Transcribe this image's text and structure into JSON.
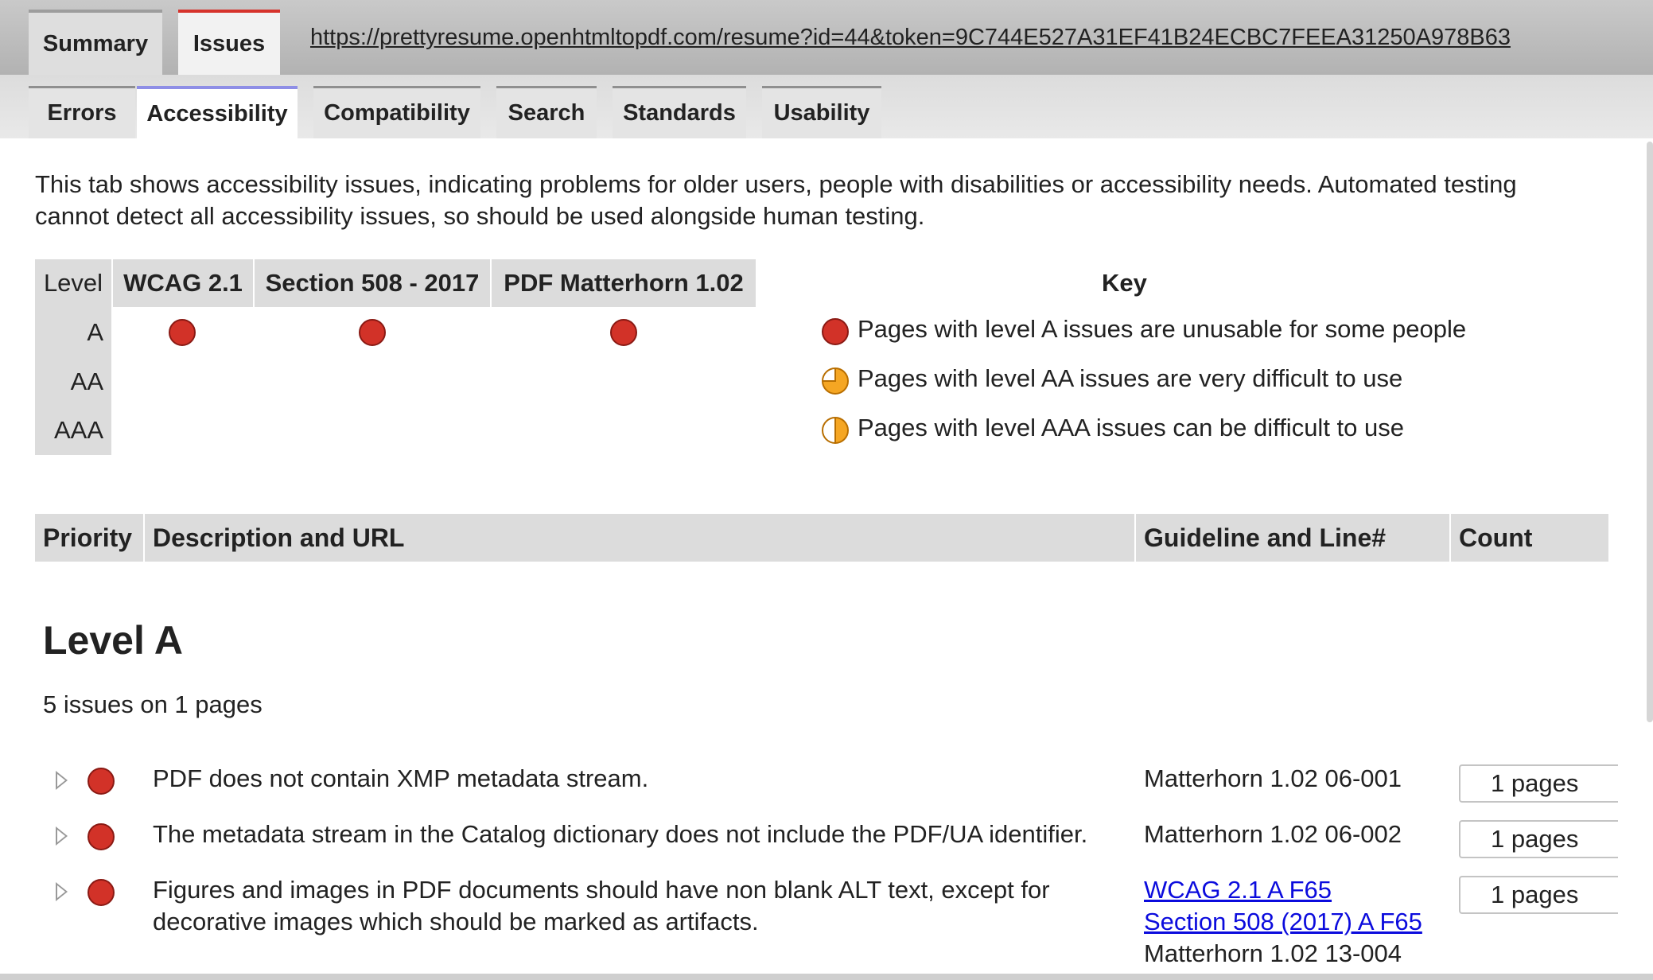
{
  "top_tabs": [
    {
      "label": "Summary",
      "active": false
    },
    {
      "label": "Issues",
      "active": true
    }
  ],
  "url": "https://prettyresume.openhtmltopdf.com/resume?id=44&token=9C744E527A31EF41B24ECBC7FEEA31250A978B63",
  "sub_tabs": [
    {
      "label": "Errors",
      "active": false
    },
    {
      "label": "Accessibility",
      "active": true
    },
    {
      "label": "Compatibility",
      "active": false
    },
    {
      "label": "Search",
      "active": false
    },
    {
      "label": "Standards",
      "active": false
    },
    {
      "label": "Usability",
      "active": false
    }
  ],
  "intro": "This tab shows accessibility issues, indicating problems for older users, people with disabilities or accessibility needs. Automated testing cannot detect all accessibility issues, so should be used alongside human testing.",
  "levels_table": {
    "headers": [
      "Level",
      "WCAG 2.1",
      "Section 508 - 2017",
      "PDF Matterhorn 1.02"
    ],
    "rows": [
      "A",
      "AA",
      "AAA"
    ]
  },
  "key": {
    "title": "Key",
    "items": [
      {
        "icon": "full-red-circle-icon",
        "text": "Pages with level A issues are unusable for some people"
      },
      {
        "icon": "three-quarter-orange-circle-icon",
        "text": "Pages with level AA issues are very difficult to use"
      },
      {
        "icon": "half-orange-circle-icon",
        "text": "Pages with level AAA issues can be difficult to use"
      }
    ]
  },
  "issues_table": {
    "headers": [
      "Priority",
      "Description and URL",
      "Guideline and Line#",
      "Count"
    ],
    "level_title": "Level A",
    "summary": "5 issues on 1 pages",
    "rows": [
      {
        "description": "PDF does not contain XMP metadata stream.",
        "guidelines": [
          {
            "text": "Matterhorn 1.02 06-001",
            "link": false
          }
        ],
        "count": "1 pages"
      },
      {
        "description": "The metadata stream in the Catalog dictionary does not include the PDF/UA identifier.",
        "guidelines": [
          {
            "text": "Matterhorn 1.02 06-002",
            "link": false
          }
        ],
        "count": "1 pages"
      },
      {
        "description": "Figures and images in PDF documents should have non blank ALT text, except for decorative images which should be marked as artifacts.",
        "guidelines": [
          {
            "text": "WCAG 2.1 A F65",
            "link": true
          },
          {
            "text": "Section 508 (2017) A F65",
            "link": true
          },
          {
            "text": "Matterhorn 1.02 13-004",
            "link": false
          }
        ],
        "count": "1 pages"
      }
    ]
  },
  "colors": {
    "level_a": "#d23228",
    "level_aa": "#f5a623",
    "active_tab_accent": "#d6332c",
    "link": "#0b0bdd"
  }
}
